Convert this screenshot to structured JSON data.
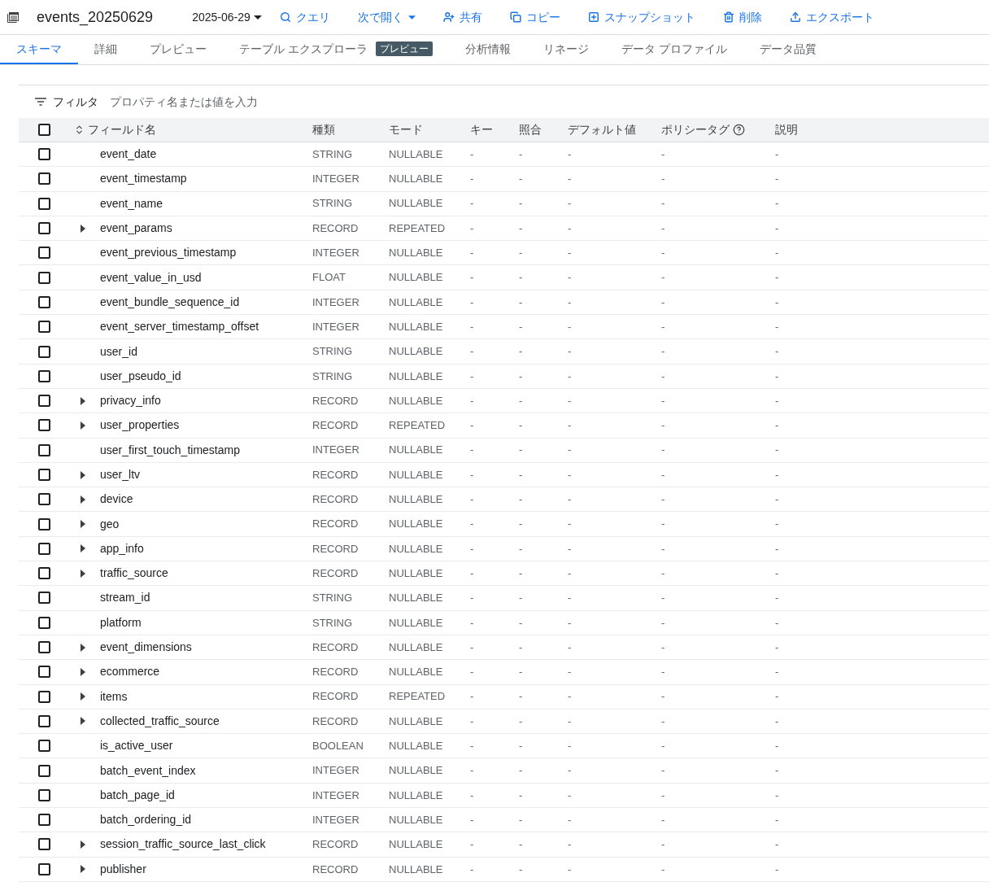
{
  "header": {
    "title": "events_20250629",
    "date": "2025-06-29",
    "actions": [
      {
        "kind": "query",
        "label": "クエリ"
      },
      {
        "kind": "open",
        "label": "次で開く"
      },
      {
        "kind": "share",
        "label": "共有"
      },
      {
        "kind": "copy",
        "label": "コピー"
      },
      {
        "kind": "snapshot",
        "label": "スナップショット"
      },
      {
        "kind": "delete",
        "label": "削除"
      },
      {
        "kind": "export",
        "label": "エクスポート"
      }
    ]
  },
  "tabs": [
    {
      "label": "スキーマ",
      "selected": true
    },
    {
      "label": "詳細",
      "selected": false
    },
    {
      "label": "プレビュー",
      "selected": false
    },
    {
      "label": "テーブル エクスプローラ",
      "badge": "プレビュー",
      "selected": false
    },
    {
      "label": "分析情報",
      "selected": false
    },
    {
      "label": "リネージ",
      "selected": false
    },
    {
      "label": "データ プロファイル",
      "selected": false
    },
    {
      "label": "データ品質",
      "selected": false
    }
  ],
  "filter": {
    "label": "フィルタ",
    "placeholder": "プロパティ名または値を入力"
  },
  "table": {
    "all_checked": false,
    "columns": [
      "フィールド名",
      "種類",
      "モード",
      "キー",
      "照合",
      "デフォルト値",
      "ポリシータグ",
      "説明"
    ],
    "rows": [
      {
        "name": "event_date",
        "type": "STRING",
        "mode": "NULLABLE",
        "key": "-",
        "collation": "-",
        "default": "-",
        "policy_tags": "-",
        "description": "-",
        "expandable": false,
        "checked": false
      },
      {
        "name": "event_timestamp",
        "type": "INTEGER",
        "mode": "NULLABLE",
        "key": "-",
        "collation": "-",
        "default": "-",
        "policy_tags": "-",
        "description": "-",
        "expandable": false,
        "checked": false
      },
      {
        "name": "event_name",
        "type": "STRING",
        "mode": "NULLABLE",
        "key": "-",
        "collation": "-",
        "default": "-",
        "policy_tags": "-",
        "description": "-",
        "expandable": false,
        "checked": false
      },
      {
        "name": "event_params",
        "type": "RECORD",
        "mode": "REPEATED",
        "key": "-",
        "collation": "-",
        "default": "-",
        "policy_tags": "-",
        "description": "-",
        "expandable": true,
        "checked": false
      },
      {
        "name": "event_previous_timestamp",
        "type": "INTEGER",
        "mode": "NULLABLE",
        "key": "-",
        "collation": "-",
        "default": "-",
        "policy_tags": "-",
        "description": "-",
        "expandable": false,
        "checked": false
      },
      {
        "name": "event_value_in_usd",
        "type": "FLOAT",
        "mode": "NULLABLE",
        "key": "-",
        "collation": "-",
        "default": "-",
        "policy_tags": "-",
        "description": "-",
        "expandable": false,
        "checked": false
      },
      {
        "name": "event_bundle_sequence_id",
        "type": "INTEGER",
        "mode": "NULLABLE",
        "key": "-",
        "collation": "-",
        "default": "-",
        "policy_tags": "-",
        "description": "-",
        "expandable": false,
        "checked": false
      },
      {
        "name": "event_server_timestamp_offset",
        "type": "INTEGER",
        "mode": "NULLABLE",
        "key": "-",
        "collation": "-",
        "default": "-",
        "policy_tags": "-",
        "description": "-",
        "expandable": false,
        "checked": false
      },
      {
        "name": "user_id",
        "type": "STRING",
        "mode": "NULLABLE",
        "key": "-",
        "collation": "-",
        "default": "-",
        "policy_tags": "-",
        "description": "-",
        "expandable": false,
        "checked": false
      },
      {
        "name": "user_pseudo_id",
        "type": "STRING",
        "mode": "NULLABLE",
        "key": "-",
        "collation": "-",
        "default": "-",
        "policy_tags": "-",
        "description": "-",
        "expandable": false,
        "checked": false
      },
      {
        "name": "privacy_info",
        "type": "RECORD",
        "mode": "NULLABLE",
        "key": "-",
        "collation": "-",
        "default": "-",
        "policy_tags": "-",
        "description": "-",
        "expandable": true,
        "checked": false
      },
      {
        "name": "user_properties",
        "type": "RECORD",
        "mode": "REPEATED",
        "key": "-",
        "collation": "-",
        "default": "-",
        "policy_tags": "-",
        "description": "-",
        "expandable": true,
        "checked": false
      },
      {
        "name": "user_first_touch_timestamp",
        "type": "INTEGER",
        "mode": "NULLABLE",
        "key": "-",
        "collation": "-",
        "default": "-",
        "policy_tags": "-",
        "description": "-",
        "expandable": false,
        "checked": false
      },
      {
        "name": "user_ltv",
        "type": "RECORD",
        "mode": "NULLABLE",
        "key": "-",
        "collation": "-",
        "default": "-",
        "policy_tags": "-",
        "description": "-",
        "expandable": true,
        "checked": false
      },
      {
        "name": "device",
        "type": "RECORD",
        "mode": "NULLABLE",
        "key": "-",
        "collation": "-",
        "default": "-",
        "policy_tags": "-",
        "description": "-",
        "expandable": true,
        "checked": false
      },
      {
        "name": "geo",
        "type": "RECORD",
        "mode": "NULLABLE",
        "key": "-",
        "collation": "-",
        "default": "-",
        "policy_tags": "-",
        "description": "-",
        "expandable": true,
        "checked": false
      },
      {
        "name": "app_info",
        "type": "RECORD",
        "mode": "NULLABLE",
        "key": "-",
        "collation": "-",
        "default": "-",
        "policy_tags": "-",
        "description": "-",
        "expandable": true,
        "checked": false
      },
      {
        "name": "traffic_source",
        "type": "RECORD",
        "mode": "NULLABLE",
        "key": "-",
        "collation": "-",
        "default": "-",
        "policy_tags": "-",
        "description": "-",
        "expandable": true,
        "checked": false
      },
      {
        "name": "stream_id",
        "type": "STRING",
        "mode": "NULLABLE",
        "key": "-",
        "collation": "-",
        "default": "-",
        "policy_tags": "-",
        "description": "-",
        "expandable": false,
        "checked": false
      },
      {
        "name": "platform",
        "type": "STRING",
        "mode": "NULLABLE",
        "key": "-",
        "collation": "-",
        "default": "-",
        "policy_tags": "-",
        "description": "-",
        "expandable": false,
        "checked": false
      },
      {
        "name": "event_dimensions",
        "type": "RECORD",
        "mode": "NULLABLE",
        "key": "-",
        "collation": "-",
        "default": "-",
        "policy_tags": "-",
        "description": "-",
        "expandable": true,
        "checked": false
      },
      {
        "name": "ecommerce",
        "type": "RECORD",
        "mode": "NULLABLE",
        "key": "-",
        "collation": "-",
        "default": "-",
        "policy_tags": "-",
        "description": "-",
        "expandable": true,
        "checked": false
      },
      {
        "name": "items",
        "type": "RECORD",
        "mode": "REPEATED",
        "key": "-",
        "collation": "-",
        "default": "-",
        "policy_tags": "-",
        "description": "-",
        "expandable": true,
        "checked": false
      },
      {
        "name": "collected_traffic_source",
        "type": "RECORD",
        "mode": "NULLABLE",
        "key": "-",
        "collation": "-",
        "default": "-",
        "policy_tags": "-",
        "description": "-",
        "expandable": true,
        "checked": false
      },
      {
        "name": "is_active_user",
        "type": "BOOLEAN",
        "mode": "NULLABLE",
        "key": "-",
        "collation": "-",
        "default": "-",
        "policy_tags": "-",
        "description": "-",
        "expandable": false,
        "checked": false
      },
      {
        "name": "batch_event_index",
        "type": "INTEGER",
        "mode": "NULLABLE",
        "key": "-",
        "collation": "-",
        "default": "-",
        "policy_tags": "-",
        "description": "-",
        "expandable": false,
        "checked": false
      },
      {
        "name": "batch_page_id",
        "type": "INTEGER",
        "mode": "NULLABLE",
        "key": "-",
        "collation": "-",
        "default": "-",
        "policy_tags": "-",
        "description": "-",
        "expandable": false,
        "checked": false
      },
      {
        "name": "batch_ordering_id",
        "type": "INTEGER",
        "mode": "NULLABLE",
        "key": "-",
        "collation": "-",
        "default": "-",
        "policy_tags": "-",
        "description": "-",
        "expandable": false,
        "checked": false
      },
      {
        "name": "session_traffic_source_last_click",
        "type": "RECORD",
        "mode": "NULLABLE",
        "key": "-",
        "collation": "-",
        "default": "-",
        "policy_tags": "-",
        "description": "-",
        "expandable": true,
        "checked": false
      },
      {
        "name": "publisher",
        "type": "RECORD",
        "mode": "NULLABLE",
        "key": "-",
        "collation": "-",
        "default": "-",
        "policy_tags": "-",
        "description": "-",
        "expandable": true,
        "checked": false
      }
    ]
  }
}
